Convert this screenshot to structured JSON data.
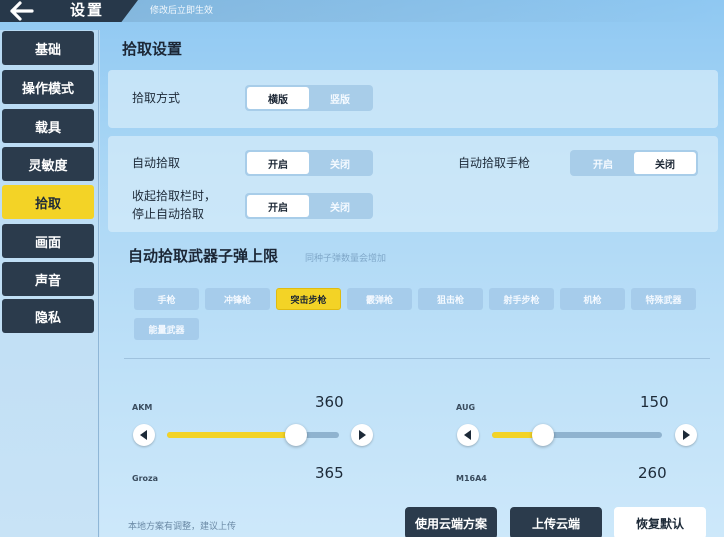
{
  "header": {
    "title": "设置",
    "hint": "修改后立即生效"
  },
  "sidebar": {
    "items": [
      {
        "label": "基础"
      },
      {
        "label": "操作模式"
      },
      {
        "label": "载具"
      },
      {
        "label": "灵敏度"
      },
      {
        "label": "拾取"
      },
      {
        "label": "画面"
      },
      {
        "label": "声音"
      },
      {
        "label": "隐私"
      }
    ],
    "active_index": 4
  },
  "pickup": {
    "title": "拾取设置",
    "mode_label": "拾取方式",
    "mode_options": [
      "横版",
      "竖版"
    ],
    "mode_selected": "横版",
    "auto_pickup_label": "自动拾取",
    "auto_pickup_options": [
      "开启",
      "关闭"
    ],
    "auto_pickup_selected": "开启",
    "auto_pistol_label": "自动拾取手枪",
    "auto_pistol_options": [
      "开启",
      "关闭"
    ],
    "auto_pistol_selected": "关闭",
    "collapse_stop_label_1": "收起拾取栏时，",
    "collapse_stop_label_2": "停止自动拾取",
    "collapse_stop_options": [
      "开启",
      "关闭"
    ],
    "collapse_stop_selected": "开启"
  },
  "ammo_limit": {
    "title": "自动拾取武器子弹上限",
    "hint": "同种子弹数量会增加",
    "categories": [
      "手枪",
      "冲锋枪",
      "突击步枪",
      "霰弹枪",
      "狙击枪",
      "射手步枪",
      "机枪",
      "特殊武器",
      "能量武器"
    ],
    "active_category": "突击步枪",
    "guns": [
      {
        "name": "AKM",
        "value": "360",
        "level": 0.75
      },
      {
        "name": "AUG",
        "value": "150",
        "level": 0.3
      },
      {
        "name": "Groza",
        "value": "365"
      },
      {
        "name": "M16A4",
        "value": "260"
      }
    ]
  },
  "footer": {
    "hint": "本地方案有调整，建议上传",
    "buttons": [
      "使用云端方案",
      "上传云端",
      "恢复默认"
    ]
  },
  "colors": {
    "accent": "#f3d326",
    "dark": "#2b3b4c"
  }
}
